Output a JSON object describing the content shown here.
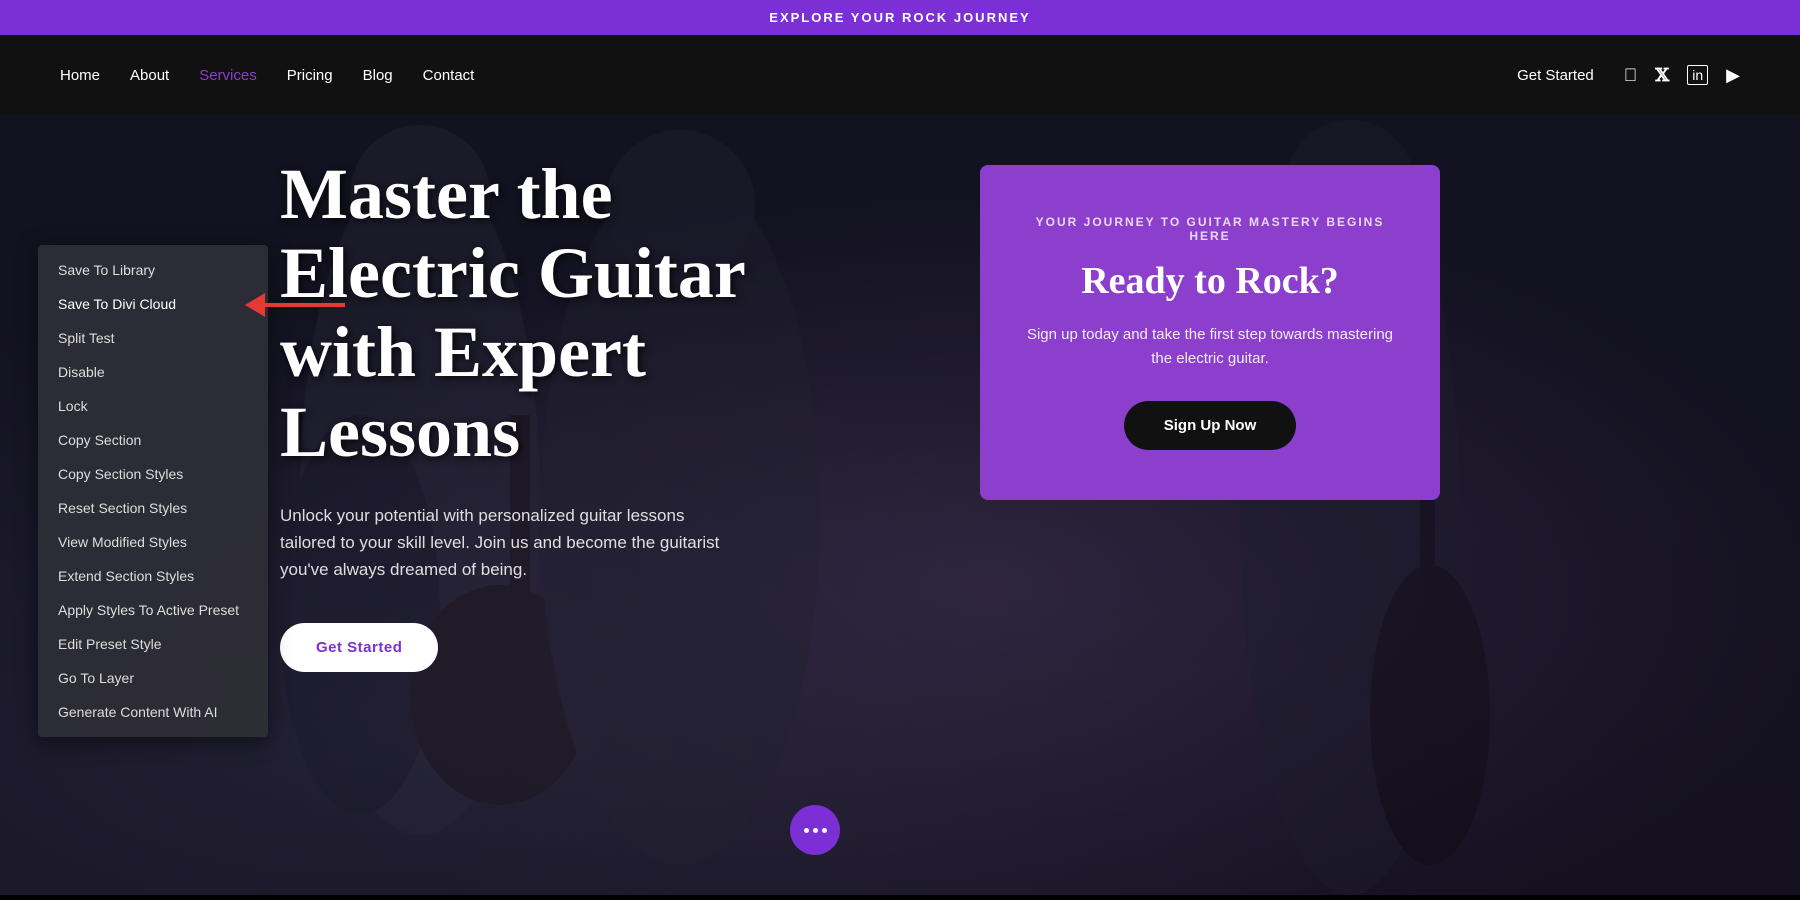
{
  "banner": {
    "text": "EXPLORE YOUR ROCK JOURNEY"
  },
  "nav": {
    "links": [
      {
        "label": "Home",
        "active": false
      },
      {
        "label": "About",
        "active": false
      },
      {
        "label": "Services",
        "active": true
      },
      {
        "label": "Pricing",
        "active": false
      },
      {
        "label": "Blog",
        "active": false
      },
      {
        "label": "Contact",
        "active": false
      }
    ],
    "cta": "Get Started",
    "social": [
      "facebook",
      "x-twitter",
      "linkedin",
      "youtube"
    ]
  },
  "hero": {
    "title": "Master the Electric Guitar with Expert Lessons",
    "subtitle": "Unlock your potential with personalized guitar lessons tailored to your skill level. Join us and become the guitarist you've always dreamed of being.",
    "cta_button": "Get Started"
  },
  "promo_card": {
    "label": "YOUR JOURNEY TO GUITAR MASTERY BEGINS HERE",
    "title": "Ready to Rock?",
    "text": "Sign up today and take the first step towards mastering the electric guitar.",
    "button": "Sign Up Now"
  },
  "context_menu": {
    "items": [
      "Save To Library",
      "Save To Divi Cloud",
      "Split Test",
      "Disable",
      "Lock",
      "Copy Section",
      "Copy Section Styles",
      "Reset Section Styles",
      "View Modified Styles",
      "Extend Section Styles",
      "Apply Styles To Active Preset",
      "Edit Preset Style",
      "Go To Layer",
      "Generate Content With AI"
    ],
    "highlighted_index": 1
  },
  "icons": {
    "facebook": "f",
    "x_twitter": "𝕏",
    "linkedin": "in",
    "youtube": "▶"
  }
}
